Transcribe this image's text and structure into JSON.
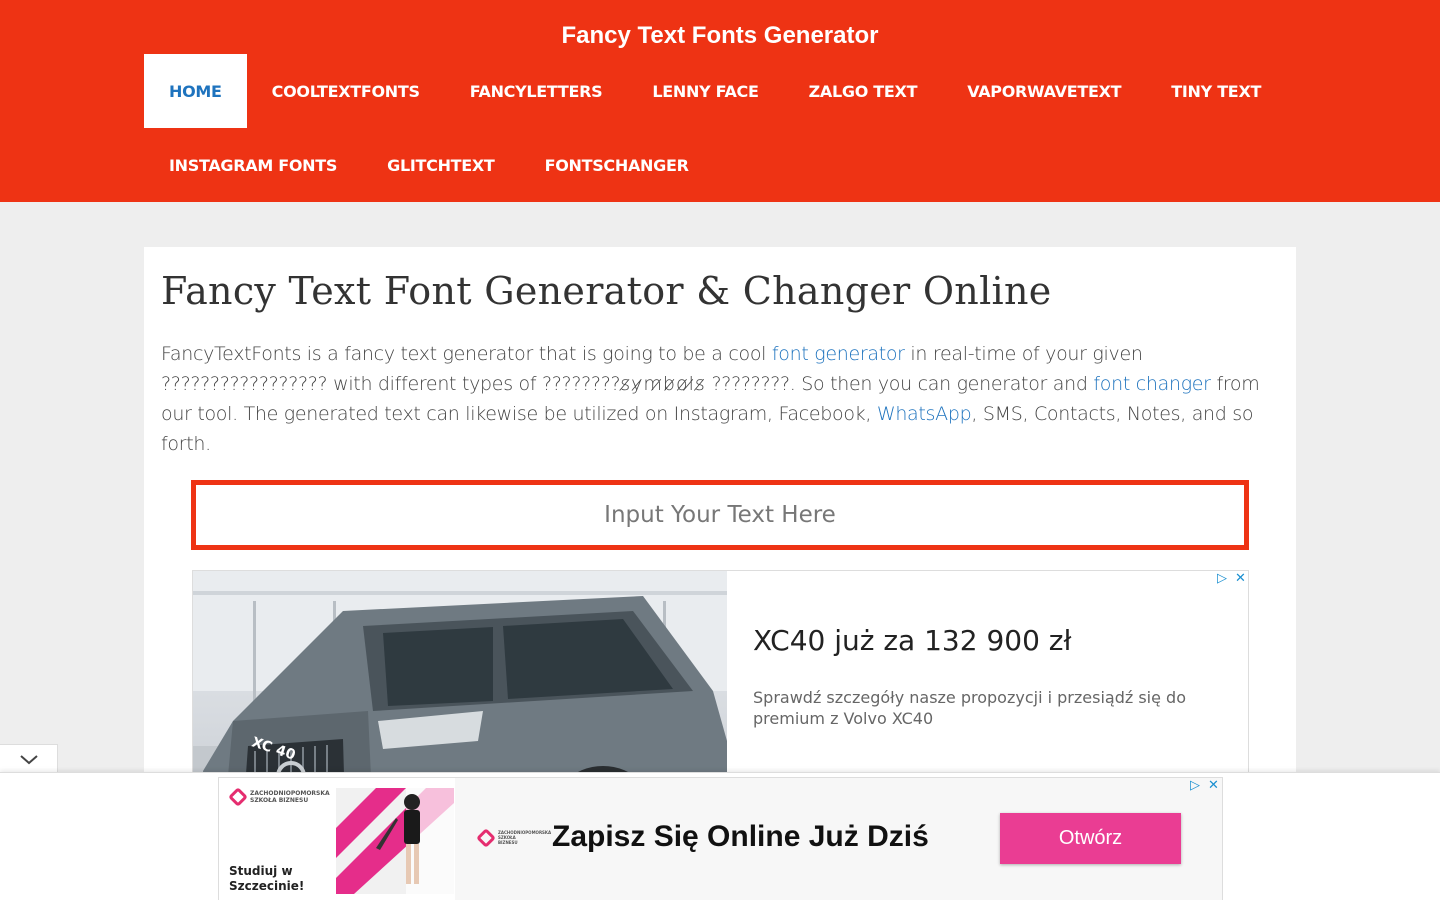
{
  "header": {
    "site_title": "Fancy Text Fonts Generator",
    "nav": [
      {
        "label": "HOME",
        "active": true
      },
      {
        "label": "COOLTEXTFONTS"
      },
      {
        "label": "FANCYLETTERS"
      },
      {
        "label": "LENNY FACE"
      },
      {
        "label": "ZALGO TEXT"
      },
      {
        "label": "VAPORWAVETEXT"
      },
      {
        "label": "TINY TEXT"
      },
      {
        "label": "INSTAGRAM FONTS"
      },
      {
        "label": "GLITCHTEXT"
      },
      {
        "label": "FONTSCHANGER"
      }
    ]
  },
  "main": {
    "page_title": "Fancy Text Font Generator & Changer Online",
    "intro": {
      "t1": "FancyTextFonts is a fancy text generator that is going to be a cool ",
      "link1": "font generator",
      "t2": " in real-time of your given ????????????????? with different types of ????????",
      "glitch": "s̷y̷m̷b̷o̷l̷s̷",
      "t3": " ????????. So then you can generator and ",
      "link2": "font changer",
      "t4": " from our tool. The generated text can likewise be utilized on Instagram, Facebook, ",
      "link3": "WhatsApp",
      "t5": ", SMS, Contacts, Notes, and so forth."
    },
    "input": {
      "placeholder": "Input Your Text Here",
      "value": ""
    }
  },
  "ad_top": {
    "headline": "XC40 już za 132 900 zł",
    "description": "Sprawdź szczegóły nasze propozycji i przesiądź się do premium z Volvo XC40",
    "plate": "XC 40",
    "adchoices_icon": "adchoices-icon",
    "close_icon": "close-icon"
  },
  "ad_bottom": {
    "logo_text": "ZACHODNIOPOMORSKA SZKOŁA BIZNESU",
    "left_text": "Studiuj w Szczecinie!",
    "headline": "Zapisz Się Online Już Dziś",
    "cta": "Otwórz",
    "cta_color": "#ea3d93"
  },
  "colors": {
    "accent": "#ee3314",
    "link": "#1e73be"
  }
}
